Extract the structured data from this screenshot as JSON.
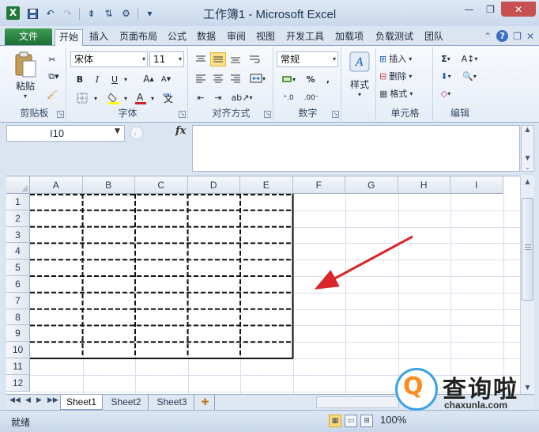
{
  "titlebar": {
    "title": "工作簿1 - Microsoft Excel",
    "app_icon": "X",
    "qat": [
      "save-icon",
      "undo-icon",
      "redo-icon",
      "format-icon",
      "sort-icon",
      "custom-icon",
      "more-icon"
    ],
    "controls": {
      "minimize": "—",
      "restore": "❐",
      "close": "✕"
    }
  },
  "ribbon_tabs": {
    "file": "文件",
    "items": [
      "开始",
      "插入",
      "页面布局",
      "公式",
      "数据",
      "审阅",
      "视图",
      "开发工具",
      "加载项",
      "负载测试",
      "团队"
    ],
    "active": "开始",
    "right_icons": [
      "minimize-ribbon-icon",
      "help-icon",
      "window-restore-icon",
      "window-close-icon"
    ]
  },
  "ribbon": {
    "clipboard": {
      "label": "剪贴板",
      "paste": "粘贴"
    },
    "font": {
      "label": "字体",
      "name": "宋体",
      "size": "11",
      "bold": "B",
      "italic": "I",
      "underline": "U",
      "grow": "A",
      "shrink": "A",
      "phonetic": "wén"
    },
    "alignment": {
      "label": "对齐方式"
    },
    "number": {
      "label": "数字",
      "format": "常规",
      "percent": "%",
      "comma": ",",
      "inc": ".0",
      "dec": ".00"
    },
    "styles": {
      "label": "样式",
      "button": "样式"
    },
    "cells": {
      "label": "单元格",
      "insert": "插入",
      "delete": "删除",
      "format": "格式"
    },
    "editing": {
      "label": "编辑",
      "sum": "Σ"
    }
  },
  "formula_bar": {
    "name_box": "I10",
    "fx": "fx",
    "formula": ""
  },
  "grid": {
    "columns": [
      "A",
      "B",
      "C",
      "D",
      "E",
      "F",
      "G",
      "H",
      "I"
    ],
    "rows": [
      "1",
      "2",
      "3",
      "4",
      "5",
      "6",
      "7",
      "8",
      "9",
      "10",
      "11",
      "12"
    ],
    "bordered_range": "A1:E10",
    "border_style": "dashed inner, solid outer"
  },
  "sheets": {
    "tabs": [
      "Sheet1",
      "Sheet2",
      "Sheet3"
    ],
    "active": "Sheet1"
  },
  "status_bar": {
    "status": "就绪",
    "zoom": "100%"
  },
  "watermark": {
    "text": "查询啦",
    "url": "chaxunla.com"
  },
  "colors": {
    "arrow": "#d9262a",
    "file_tab": "#2a8443",
    "ribbon_bg": "#dbe5f1"
  }
}
